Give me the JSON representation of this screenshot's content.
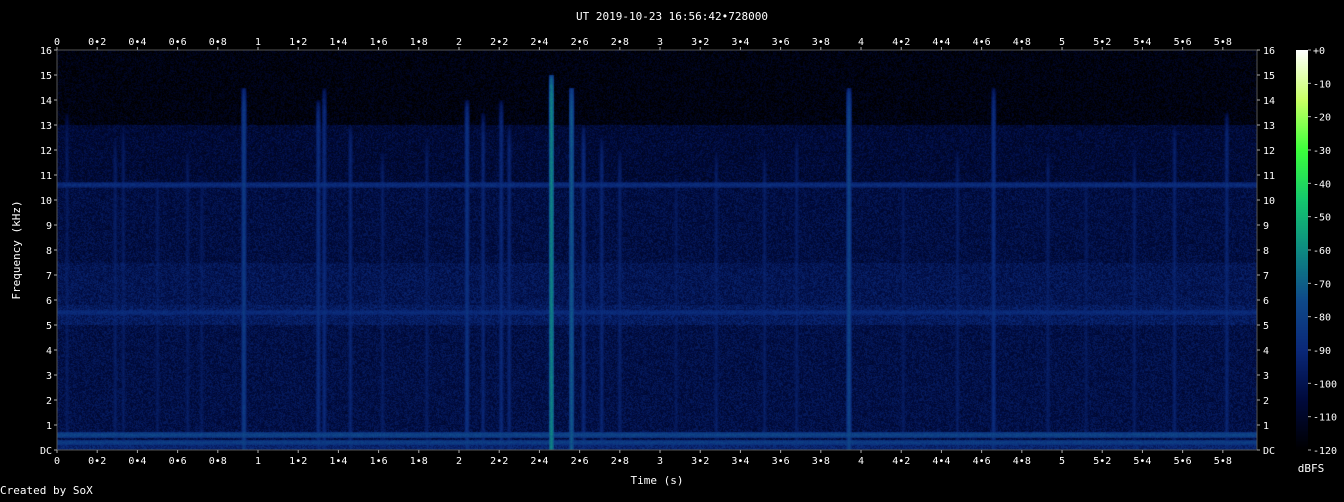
{
  "chart_data": {
    "type": "heatmap",
    "title": "UT 2019-10-23 16:56:42•728000",
    "xlabel": "Time (s)",
    "ylabel": "Frequency (kHz)",
    "credit": "Created by SoX",
    "colorbar_label": "dBFS",
    "xlim": [
      0,
      5.97
    ],
    "ylim": [
      0,
      16
    ],
    "x_ticks": [
      {
        "value": 0,
        "label": "0"
      },
      {
        "value": 0.2,
        "label": "0•2"
      },
      {
        "value": 0.4,
        "label": "0•4"
      },
      {
        "value": 0.6,
        "label": "0•6"
      },
      {
        "value": 0.8,
        "label": "0•8"
      },
      {
        "value": 1,
        "label": "1"
      },
      {
        "value": 1.2,
        "label": "1•2"
      },
      {
        "value": 1.4,
        "label": "1•4"
      },
      {
        "value": 1.6,
        "label": "1•6"
      },
      {
        "value": 1.8,
        "label": "1•8"
      },
      {
        "value": 2,
        "label": "2"
      },
      {
        "value": 2.2,
        "label": "2•2"
      },
      {
        "value": 2.4,
        "label": "2•4"
      },
      {
        "value": 2.6,
        "label": "2•6"
      },
      {
        "value": 2.8,
        "label": "2•8"
      },
      {
        "value": 3,
        "label": "3"
      },
      {
        "value": 3.2,
        "label": "3•2"
      },
      {
        "value": 3.4,
        "label": "3•4"
      },
      {
        "value": 3.6,
        "label": "3•6"
      },
      {
        "value": 3.8,
        "label": "3•8"
      },
      {
        "value": 4,
        "label": "4"
      },
      {
        "value": 4.2,
        "label": "4•2"
      },
      {
        "value": 4.4,
        "label": "4•4"
      },
      {
        "value": 4.6,
        "label": "4•6"
      },
      {
        "value": 4.8,
        "label": "4•8"
      },
      {
        "value": 5,
        "label": "5"
      },
      {
        "value": 5.2,
        "label": "5•2"
      },
      {
        "value": 5.4,
        "label": "5•4"
      },
      {
        "value": 5.6,
        "label": "5•6"
      },
      {
        "value": 5.8,
        "label": "5•8"
      }
    ],
    "y_ticks": [
      {
        "value": 0,
        "label": "DC"
      },
      {
        "value": 1,
        "label": "1"
      },
      {
        "value": 2,
        "label": "2"
      },
      {
        "value": 3,
        "label": "3"
      },
      {
        "value": 4,
        "label": "4"
      },
      {
        "value": 5,
        "label": "5"
      },
      {
        "value": 6,
        "label": "6"
      },
      {
        "value": 7,
        "label": "7"
      },
      {
        "value": 8,
        "label": "8"
      },
      {
        "value": 9,
        "label": "9"
      },
      {
        "value": 10,
        "label": "10"
      },
      {
        "value": 11,
        "label": "11"
      },
      {
        "value": 12,
        "label": "12"
      },
      {
        "value": 13,
        "label": "13"
      },
      {
        "value": 14,
        "label": "14"
      },
      {
        "value": 15,
        "label": "15"
      },
      {
        "value": 16,
        "label": "16"
      }
    ],
    "colorbar_ticks": [
      {
        "value": 0,
        "label": "+0"
      },
      {
        "value": -10,
        "label": "-10"
      },
      {
        "value": -20,
        "label": "-20"
      },
      {
        "value": -30,
        "label": "-30"
      },
      {
        "value": -40,
        "label": "-40"
      },
      {
        "value": -50,
        "label": "-50"
      },
      {
        "value": -60,
        "label": "-60"
      },
      {
        "value": -70,
        "label": "-70"
      },
      {
        "value": -80,
        "label": "-80"
      },
      {
        "value": -90,
        "label": "-90"
      },
      {
        "value": -100,
        "label": "-100"
      },
      {
        "value": -110,
        "label": "-110"
      },
      {
        "value": -120,
        "label": "-120"
      }
    ],
    "colorbar_range": [
      -120,
      0
    ],
    "colormap": [
      "#000000",
      "#000a3c",
      "#0a2878",
      "#0f4a8a",
      "#0d8a82",
      "#14c86e",
      "#3cff3c",
      "#c8ff64",
      "#ffffff"
    ],
    "noise_floor": {
      "bands": [
        {
          "f_low": 0,
          "f_high": 0.35,
          "db": -92
        },
        {
          "f_low": 0.35,
          "f_high": 5,
          "db": -102
        },
        {
          "f_low": 5,
          "f_high": 5.8,
          "db": -96
        },
        {
          "f_low": 5.8,
          "f_high": 7.5,
          "db": -99
        },
        {
          "f_low": 7.5,
          "f_high": 10.5,
          "db": -103
        },
        {
          "f_low": 10.5,
          "f_high": 13,
          "db": -106
        },
        {
          "f_low": 13,
          "f_high": 16,
          "db": -116
        }
      ]
    },
    "horizontal_lines": [
      {
        "freq": 10.6,
        "db": -88
      },
      {
        "freq": 5.5,
        "db": -90
      },
      {
        "freq": 0.6,
        "db": -78
      },
      {
        "freq": 0.3,
        "db": -82
      }
    ],
    "impulses": [
      {
        "t": 0.05,
        "f_top": 13.5,
        "db": -98
      },
      {
        "t": 0.29,
        "f_top": 12.5,
        "db": -96
      },
      {
        "t": 0.33,
        "f_top": 13,
        "db": -97
      },
      {
        "t": 0.5,
        "f_top": 11,
        "db": -98
      },
      {
        "t": 0.65,
        "f_top": 12,
        "db": -97
      },
      {
        "t": 0.72,
        "f_top": 11,
        "db": -98
      },
      {
        "t": 0.93,
        "f_top": 14.5,
        "db": -82
      },
      {
        "t": 1.3,
        "f_top": 14,
        "db": -88
      },
      {
        "t": 1.33,
        "f_top": 14.5,
        "db": -90
      },
      {
        "t": 1.46,
        "f_top": 13,
        "db": -92
      },
      {
        "t": 1.62,
        "f_top": 12,
        "db": -96
      },
      {
        "t": 1.84,
        "f_top": 12.5,
        "db": -96
      },
      {
        "t": 2.04,
        "f_top": 14,
        "db": -86
      },
      {
        "t": 2.12,
        "f_top": 13.5,
        "db": -92
      },
      {
        "t": 2.21,
        "f_top": 14,
        "db": -90
      },
      {
        "t": 2.25,
        "f_top": 13,
        "db": -92
      },
      {
        "t": 2.46,
        "f_top": 15,
        "db": -62
      },
      {
        "t": 2.56,
        "f_top": 14.5,
        "db": -72
      },
      {
        "t": 2.62,
        "f_top": 13,
        "db": -90
      },
      {
        "t": 2.71,
        "f_top": 12.5,
        "db": -92
      },
      {
        "t": 2.8,
        "f_top": 12,
        "db": -94
      },
      {
        "t": 3.08,
        "f_top": 11,
        "db": -98
      },
      {
        "t": 3.28,
        "f_top": 12,
        "db": -96
      },
      {
        "t": 3.52,
        "f_top": 12,
        "db": -96
      },
      {
        "t": 3.68,
        "f_top": 12.5,
        "db": -96
      },
      {
        "t": 3.94,
        "f_top": 14.5,
        "db": -78
      },
      {
        "t": 4.21,
        "f_top": 11,
        "db": -98
      },
      {
        "t": 4.48,
        "f_top": 12,
        "db": -96
      },
      {
        "t": 4.66,
        "f_top": 14.5,
        "db": -88
      },
      {
        "t": 4.93,
        "f_top": 12,
        "db": -96
      },
      {
        "t": 5.12,
        "f_top": 11,
        "db": -98
      },
      {
        "t": 5.36,
        "f_top": 12,
        "db": -96
      },
      {
        "t": 5.56,
        "f_top": 13,
        "db": -94
      },
      {
        "t": 5.82,
        "f_top": 13.5,
        "db": -92
      }
    ]
  }
}
